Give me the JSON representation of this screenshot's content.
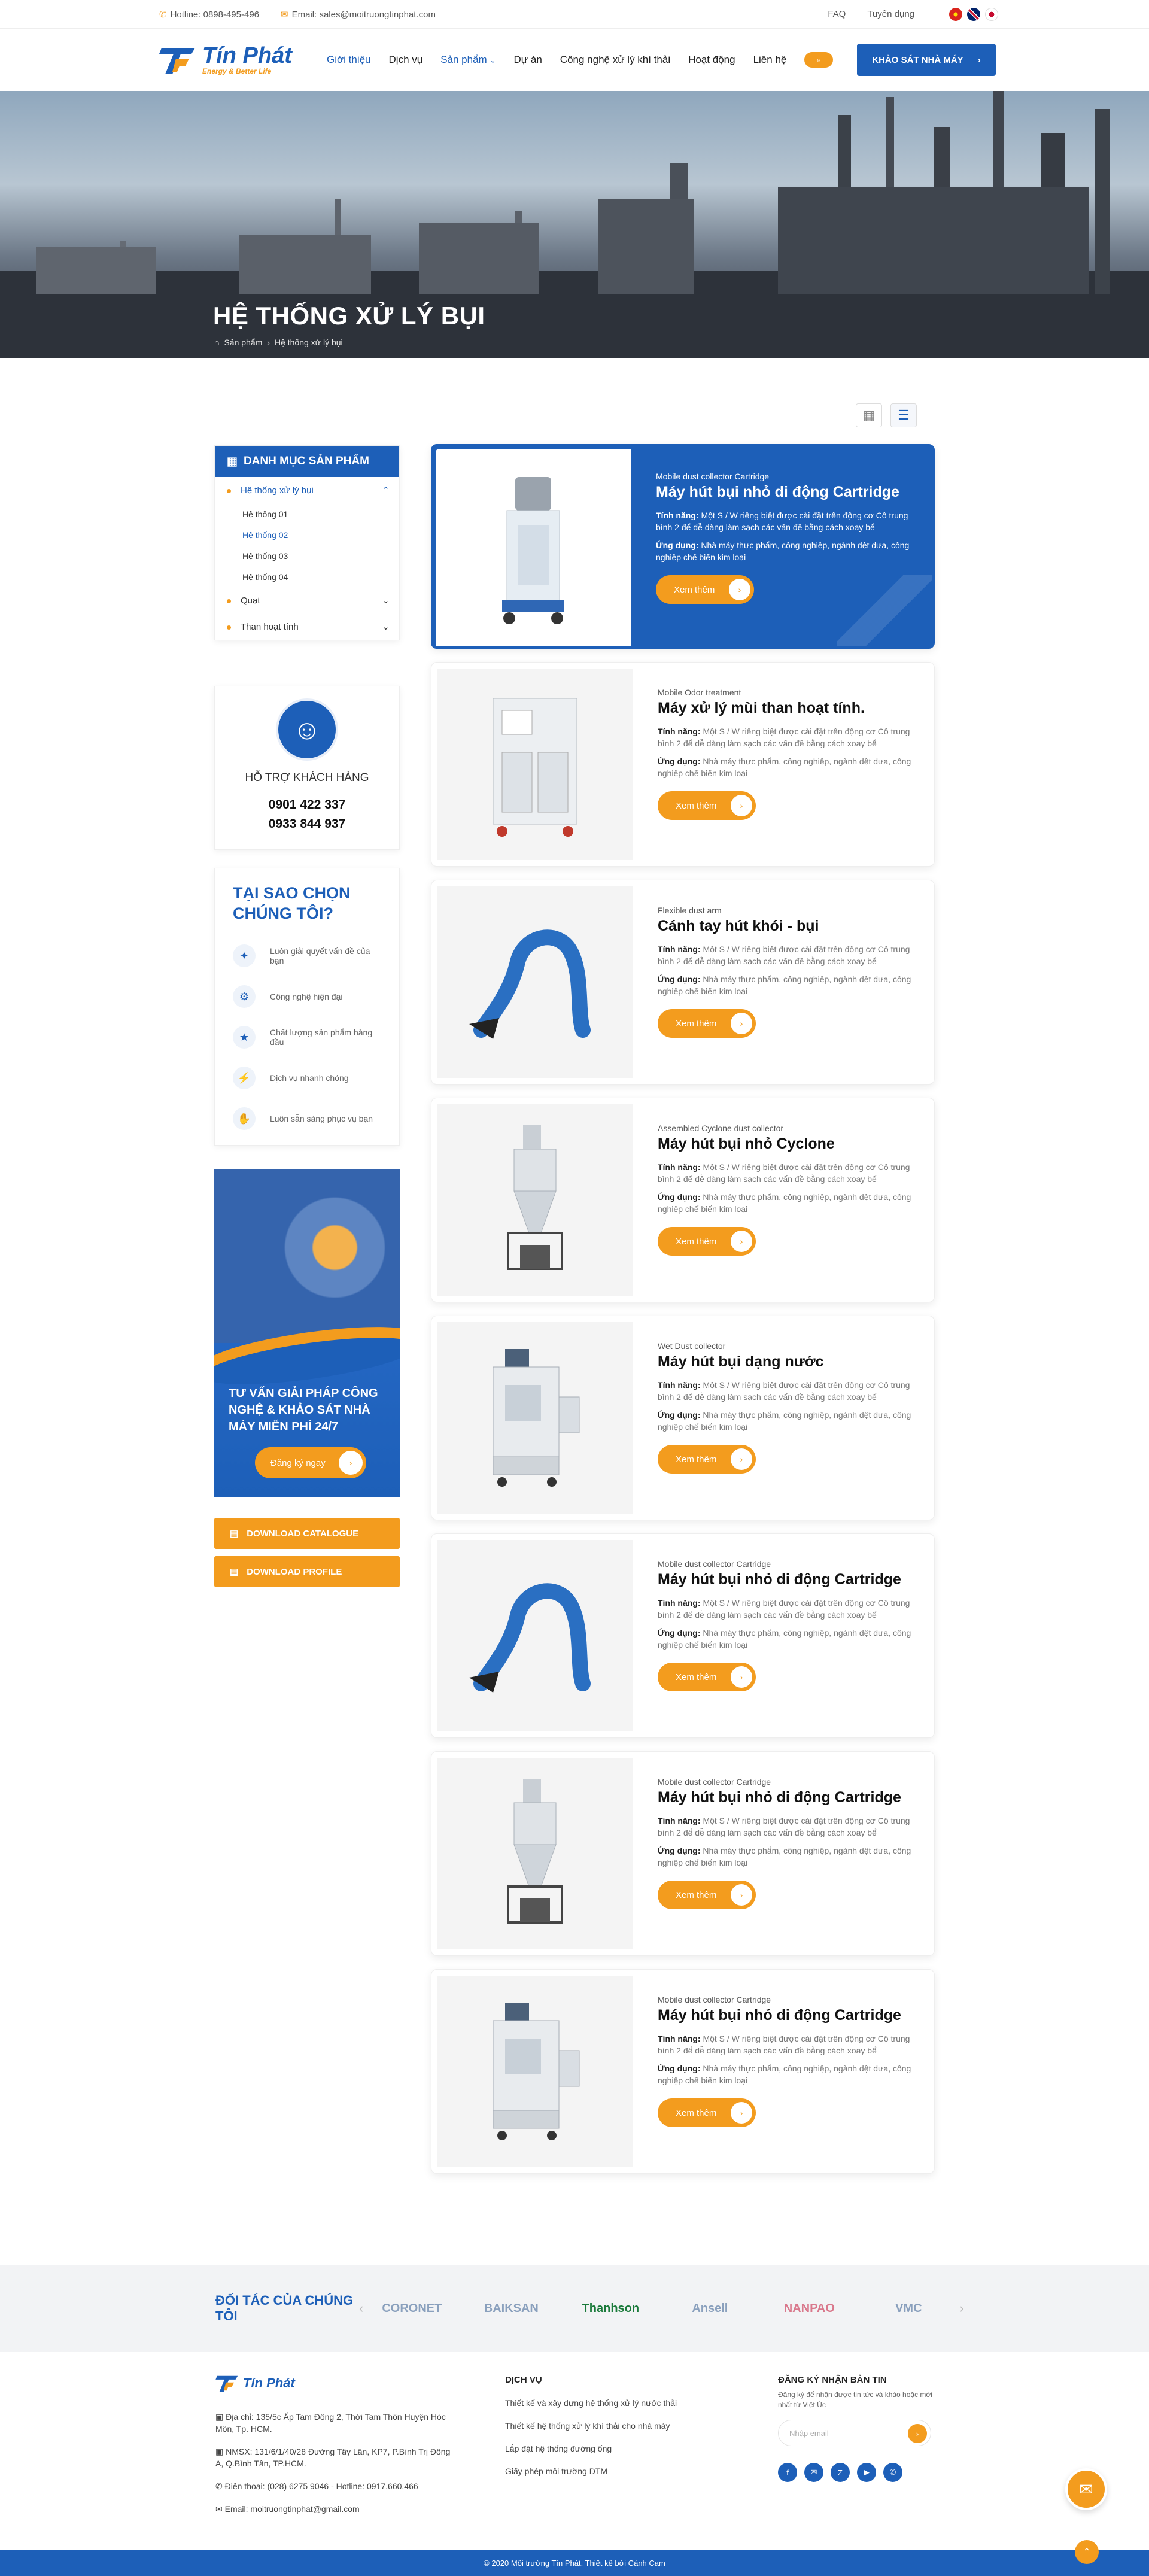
{
  "topbar": {
    "hotline": "Hotline: 0898-495-496",
    "email": "Email: sales@moitruongtinphat.com",
    "faq": "FAQ",
    "careers": "Tuyển dụng"
  },
  "brand": {
    "name": "Tín Phát",
    "tagline": "Energy & Better Life"
  },
  "nav": {
    "items": [
      "Giới thiệu",
      "Dịch vụ",
      "Sản phẩm",
      "Dự án",
      "Công nghệ xử lý khí thải",
      "Hoạt động",
      "Liên hệ"
    ],
    "cta": "KHẢO SÁT NHÀ MÁY"
  },
  "hero": {
    "title": "HỆ THỐNG XỬ LÝ BỤI",
    "breadcrumb": [
      "Sản phẩm",
      "Hệ thống xử lý bụi"
    ]
  },
  "sidebar": {
    "categories_title": "DANH MỤC SẢN PHẨM",
    "categories": [
      {
        "label": "Hệ thống xử lý bụi",
        "children": [
          "Hệ thống 01",
          "Hệ thống 02",
          "Hệ thống 03",
          "Hệ thống 04"
        ]
      },
      {
        "label": "Quạt"
      },
      {
        "label": "Than hoạt tính"
      }
    ],
    "support_title": "HỖ TRỢ KHÁCH HÀNG",
    "phones": [
      "0901 422 337",
      "0933 844 937"
    ],
    "why_title": "TẠI SAO CHỌN CHÚNG TÔI?",
    "why_items": [
      "Luôn giải quyết vấn đề của bạn",
      "Công nghệ hiện đại",
      "Chất lượng sản phẩm hàng đầu",
      "Dịch vụ nhanh chóng",
      "Luôn sẵn sàng phục vụ bạn"
    ],
    "promo_text": "TƯ VẤN GIẢI PHÁP CÔNG NGHỆ & KHẢO SÁT NHÀ MÁY MIỄN PHÍ 24/7",
    "promo_button": "Đăng ký ngay",
    "download_catalogue": "DOWNLOAD CATALOGUE",
    "download_profile": "DOWNLOAD PROFILE"
  },
  "labels": {
    "feature": "Tính năng:",
    "usage": "Ứng dụng:",
    "feature_text": "Một S / W riêng biệt được cài đặt trên động cơ Cô trung bình 2 để dễ dàng làm sạch các vấn đề bằng cách xoay bể",
    "usage_text": "Nhà máy thực phẩm, công nghiệp, ngành dệt dưa, công nghiệp chế biến kim loại",
    "more": "Xem thêm"
  },
  "products": [
    {
      "sub": "Mobile dust collector Cartridge",
      "title": "Máy hút bụi nhỏ di động Cartridge"
    },
    {
      "sub": "Mobile Odor treatment",
      "title": "Máy xử lý mùi than hoạt tính."
    },
    {
      "sub": "Flexible dust arm",
      "title": "Cánh tay hút khói - bụi"
    },
    {
      "sub": "Assembled Cyclone dust collector",
      "title": "Máy hút bụi nhỏ Cyclone"
    },
    {
      "sub": "Wet Dust collector",
      "title": "Máy hút bụi dạng nước"
    },
    {
      "sub": "Mobile dust collector Cartridge",
      "title": "Máy hút bụi nhỏ di động Cartridge"
    },
    {
      "sub": "Mobile dust collector Cartridge",
      "title": "Máy hút bụi nhỏ di động Cartridge"
    },
    {
      "sub": "Mobile dust collector Cartridge",
      "title": "Máy hút bụi nhỏ di động Cartridge"
    }
  ],
  "partners": {
    "title": "ĐỐI TÁC CỦA CHÚNG TÔI",
    "logos": [
      "CORONET",
      "BAIKSAN",
      "Thanhson",
      "Ansell",
      "NANPAO",
      "VMC"
    ]
  },
  "footer": {
    "address1": "Địa chỉ: 135/5c Ấp Tam Đông 2, Thới Tam Thôn Huyện Hóc Môn, Tp. HCM.",
    "address2": "NMSX: 131/6/1/40/28 Đường Tây Lân, KP7, P.Bình Trị Đông A, Q.Bình Tân, TP.HCM.",
    "phone": "Điện thoại: (028) 6275 9046 - Hotline: 0917.660.466",
    "email": "Email: moitruongtinphat@gmail.com",
    "services_title": "DỊCH VỤ",
    "services": [
      "Thiết kế và xây dựng hệ thống xử lý nước thải",
      "Thiết kế hệ thống xử lý khí thải cho nhà máy",
      "Lắp đặt hệ thống đường ống",
      "Giấy phép môi trường DTM"
    ],
    "newsletter_title": "ĐĂNG KÝ NHẬN BẢN TIN",
    "newsletter_text": "Đăng ký để nhận được tin tức và khảo hoặc mới nhất từ Việt Úc",
    "newsletter_placeholder": "Nhập email",
    "copyright": "© 2020 Môi trường Tín Phát. Thiết kế bởi Cánh Cam"
  },
  "colors": {
    "primary": "#1d5fb8",
    "accent": "#f39c1e"
  }
}
